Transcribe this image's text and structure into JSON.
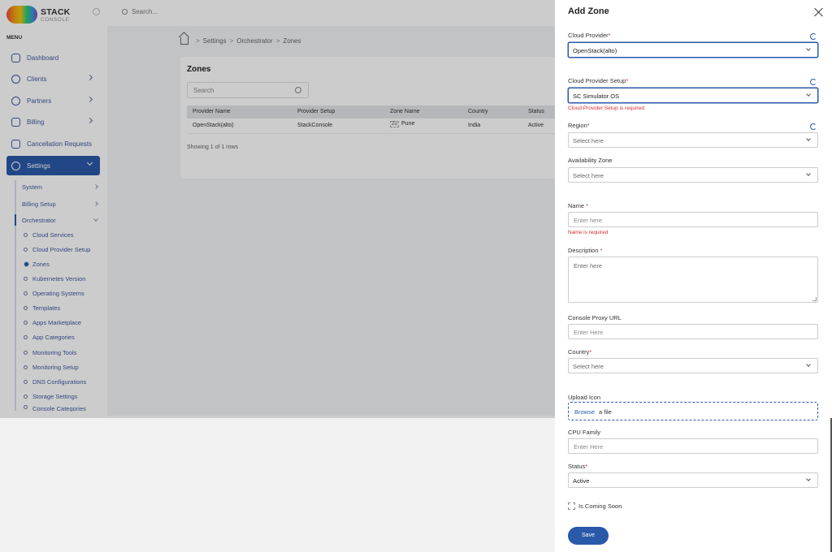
{
  "app": {
    "logo_text": "STACK",
    "logo_subtext": "CONSOLE",
    "menu_title": "MENU",
    "top_search_placeholder": "Search...",
    "nav": [
      {
        "label": "Dashboard"
      },
      {
        "label": "Clients"
      },
      {
        "label": "Partners"
      },
      {
        "label": "Billing"
      },
      {
        "label": "Cancellation Requests"
      },
      {
        "label": "Settings"
      }
    ],
    "settings_sub": [
      {
        "label": "System"
      },
      {
        "label": "Billing Setup"
      },
      {
        "label": "Orchestrator"
      }
    ],
    "orchestrator_items": [
      {
        "label": "Cloud Services"
      },
      {
        "label": "Cloud Provider Setup"
      },
      {
        "label": "Zones"
      },
      {
        "label": "Kubernetes Version"
      },
      {
        "label": "Operating Systems"
      },
      {
        "label": "Templates"
      },
      {
        "label": "Apps Marketplace"
      },
      {
        "label": "App Categories"
      },
      {
        "label": "Monitoring Tools"
      },
      {
        "label": "Monitoring Setup"
      },
      {
        "label": "DNS Configurations"
      },
      {
        "label": "Storage Settings"
      },
      {
        "label": "Console Categories"
      }
    ],
    "breadcrumb": [
      "Settings",
      "Orchestrator",
      "Zones"
    ],
    "breadcrumb_sep": ">",
    "page_title": "Zones",
    "table_search_placeholder": "Search",
    "table": {
      "headers": [
        "Provider Name",
        "Provider Setup",
        "Zone Name",
        "Country",
        "Status"
      ],
      "rows": [
        {
          "provider_name": "OpenStack(alto)",
          "provider_setup": "StackConsole",
          "zone_img_alt": "Zo",
          "zone_name": "Pune",
          "country": "India",
          "status": "Active"
        }
      ]
    },
    "showing": "Showing 1 of 1 rows"
  },
  "drawer": {
    "title": "Add Zone",
    "required_mark": "*",
    "cloud_provider": {
      "label": "Cloud Provider",
      "value": "OpenStack(alto)"
    },
    "cloud_provider_setup": {
      "label": "Cloud Provider Setup",
      "value": "SC Simulator OS",
      "error": "Cloud Provider Setup is required"
    },
    "region": {
      "label": "Region",
      "placeholder": "Select here"
    },
    "availability_zone": {
      "label": "Availability Zone",
      "placeholder": "Select here"
    },
    "name": {
      "label": "Name",
      "placeholder": "Enter here",
      "error": "Name is required"
    },
    "description": {
      "label": "Description",
      "placeholder": "Enter here"
    },
    "console_proxy_url": {
      "label": "Console Proxy URL",
      "placeholder": "Enter Here"
    },
    "country": {
      "label": "Country",
      "placeholder": "Select here"
    },
    "upload_icon": {
      "label": "Upload Icon",
      "browse": "Browse",
      "suffix": "a file"
    },
    "cpu_family": {
      "label": "CPU Family",
      "placeholder": "Enter Here"
    },
    "status": {
      "label": "Status",
      "value": "Active"
    },
    "is_coming_soon": {
      "label": "Is Coming Soon",
      "checked": false
    },
    "save_label": "Save"
  },
  "colors": {
    "primary": "#2a59a9",
    "error": "#d32f2f",
    "overlay": "rgba(0,0,0,0.2)"
  }
}
